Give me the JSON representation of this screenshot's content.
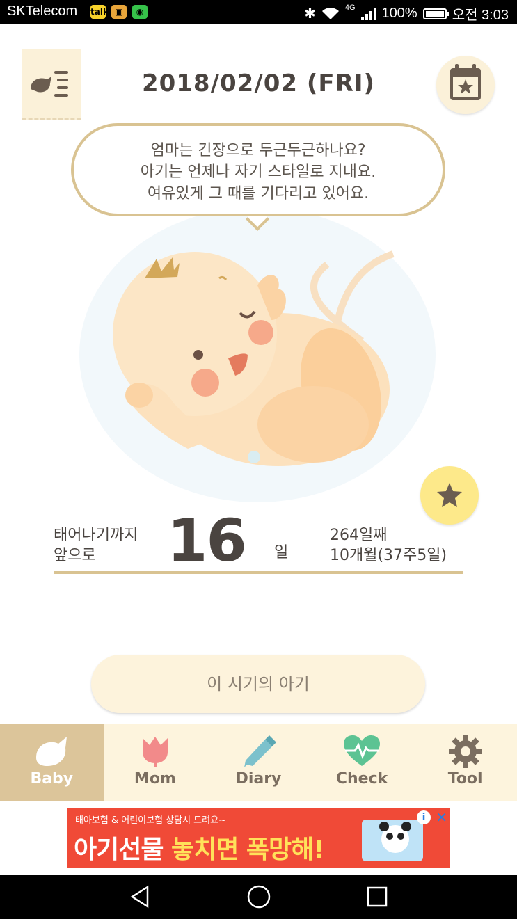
{
  "status_bar": {
    "carrier": "SKTelecom",
    "network": "4G",
    "battery": "100%",
    "time": "오전 3:03",
    "notification_icons": [
      "talk-icon",
      "bag-icon",
      "app-icon"
    ]
  },
  "header": {
    "date": "2018/02/02 (FRI)"
  },
  "bubble": {
    "lines": [
      "엄마는 긴장으로 두근두근하나요?",
      "아기는 언제나 자기 스타일로 지내요.",
      "여유있게 그 때를 기다리고 있어요."
    ]
  },
  "countdown": {
    "label_line1": "태어나기까지",
    "label_line2": "앞으로",
    "days": "16",
    "unit": "일",
    "day_count": "264일째",
    "month_week": "10개월(37주5일)"
  },
  "period_button": "이 시기의 아기",
  "tabs": [
    {
      "label": "Baby",
      "icon": "bird-icon",
      "active": true
    },
    {
      "label": "Mom",
      "icon": "tulip-icon",
      "active": false
    },
    {
      "label": "Diary",
      "icon": "pencil-icon",
      "active": false
    },
    {
      "label": "Check",
      "icon": "heartbeat-icon",
      "active": false
    },
    {
      "label": "Tool",
      "icon": "gear-icon",
      "active": false
    }
  ],
  "ad": {
    "top_text": "태아보험 & 어린이보험 상담시 드려요~",
    "main_text_1": "아기선물",
    "main_text_2": "놓치면 폭망해!"
  },
  "colors": {
    "accent_gold": "#d9c392",
    "cream": "#fdf4dd",
    "active_tab": "#dcc59a",
    "star_yellow": "#fde98a",
    "ad_red": "#f04a37"
  }
}
